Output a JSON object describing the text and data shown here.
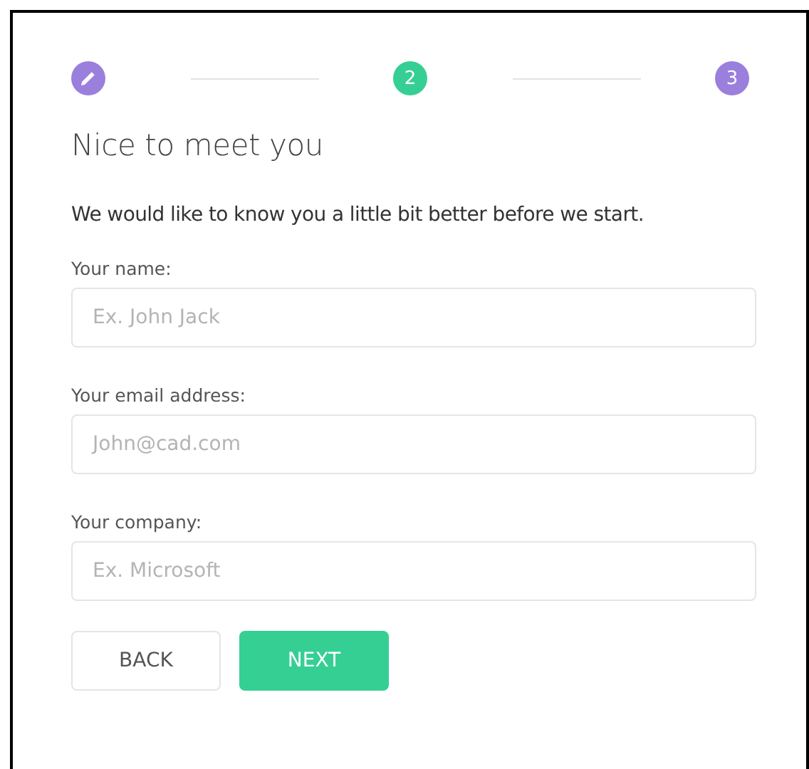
{
  "steps": [
    {
      "kind": "done",
      "selected": false
    },
    {
      "kind": "number",
      "label": "2",
      "selected": true
    },
    {
      "kind": "number",
      "label": "3",
      "selected": false
    }
  ],
  "heading": "Nice to meet you",
  "intro": "We would like to know you a little bit better before we start.",
  "fields": [
    {
      "label": "Your name:",
      "placeholder": "Ex. John Jack"
    },
    {
      "label": "Your email address:",
      "placeholder": "John@cad.com"
    },
    {
      "label": "Your company:",
      "placeholder": "Ex. Microsoft"
    }
  ],
  "buttons": [
    {
      "label": "BACK",
      "kind": "secondary"
    },
    {
      "label": "NEXT",
      "kind": "primary"
    }
  ]
}
